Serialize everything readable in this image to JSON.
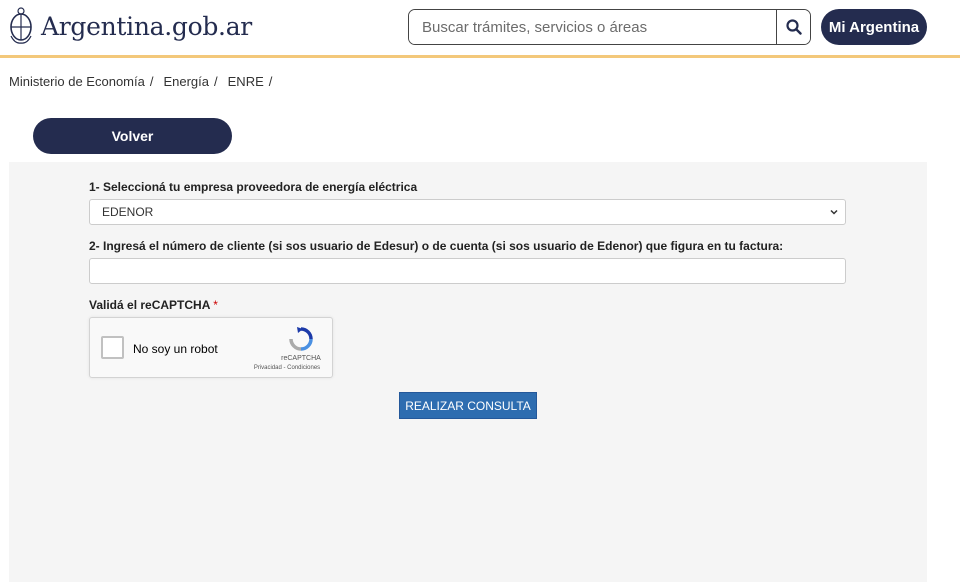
{
  "header": {
    "logo_text": "Argentina.gob.ar",
    "search_placeholder": "Buscar trámites, servicios o áreas",
    "search_button_icon": "search-icon",
    "mi_argentina_label": "Mi Argentina",
    "accent_color": "#f3c87a",
    "brand_color": "#242c4f"
  },
  "breadcrumb": {
    "items": [
      "Ministerio de Economía",
      "Energía",
      "ENRE"
    ],
    "separator": "/"
  },
  "volver_label": "Volver",
  "form": {
    "label_1": "1- Seleccioná tu empresa proveedora de energía eléctrica",
    "select_value": "EDENOR",
    "label_2": "2- Ingresá el número de cliente (si sos usuario de Edesur) o de cuenta (si sos usuario de Edenor) que figura en tu factura:",
    "label_3": "Validá el reCAPTCHA",
    "required_mark": "*",
    "captcha": {
      "checkbox_label": "No soy un robot",
      "brand": "reCAPTCHA",
      "links": "Privacidad - Condiciones"
    },
    "submit_label": "REALIZAR CONSULTA",
    "submit_color": "#2e6db0"
  }
}
